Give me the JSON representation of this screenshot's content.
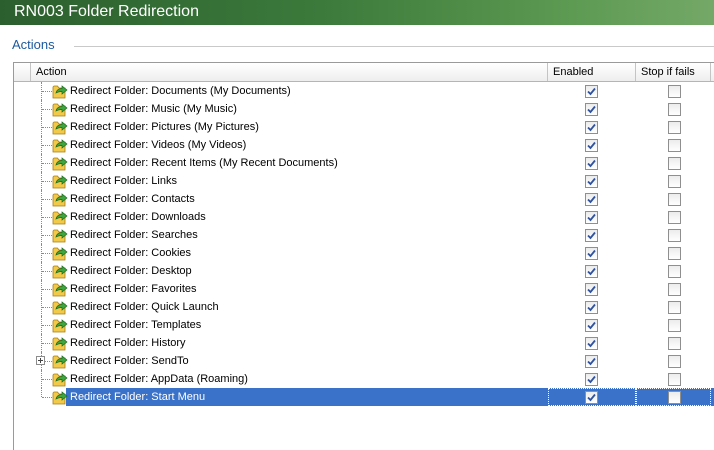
{
  "window": {
    "title": "RN003 Folder Redirection"
  },
  "section": {
    "title": "Actions"
  },
  "table": {
    "columns": {
      "action": "Action",
      "enabled": "Enabled",
      "stop": "Stop if fails"
    },
    "rows": [
      {
        "label": "Redirect Folder: Documents (My Documents)",
        "enabled": true,
        "stop_if_fails": false
      },
      {
        "label": "Redirect Folder: Music (My Music)",
        "enabled": true,
        "stop_if_fails": false
      },
      {
        "label": "Redirect Folder: Pictures (My Pictures)",
        "enabled": true,
        "stop_if_fails": false
      },
      {
        "label": "Redirect Folder: Videos (My Videos)",
        "enabled": true,
        "stop_if_fails": false
      },
      {
        "label": "Redirect Folder: Recent Items (My Recent Documents)",
        "enabled": true,
        "stop_if_fails": false
      },
      {
        "label": "Redirect Folder: Links",
        "enabled": true,
        "stop_if_fails": false
      },
      {
        "label": "Redirect Folder: Contacts",
        "enabled": true,
        "stop_if_fails": false
      },
      {
        "label": "Redirect Folder: Downloads",
        "enabled": true,
        "stop_if_fails": false
      },
      {
        "label": "Redirect Folder: Searches",
        "enabled": true,
        "stop_if_fails": false
      },
      {
        "label": "Redirect Folder: Cookies",
        "enabled": true,
        "stop_if_fails": false
      },
      {
        "label": "Redirect Folder: Desktop",
        "enabled": true,
        "stop_if_fails": false
      },
      {
        "label": "Redirect Folder: Favorites",
        "enabled": true,
        "stop_if_fails": false
      },
      {
        "label": "Redirect Folder: Quick Launch",
        "enabled": true,
        "stop_if_fails": false
      },
      {
        "label": "Redirect Folder: Templates",
        "enabled": true,
        "stop_if_fails": false
      },
      {
        "label": "Redirect Folder: History",
        "enabled": true,
        "stop_if_fails": false
      },
      {
        "label": "Redirect Folder: SendTo",
        "enabled": true,
        "stop_if_fails": false,
        "expandable": true
      },
      {
        "label": "Redirect Folder: AppData (Roaming)",
        "enabled": true,
        "stop_if_fails": false
      },
      {
        "label": "Redirect Folder: Start Menu",
        "enabled": true,
        "stop_if_fails": false,
        "selected": true
      }
    ]
  },
  "colors": {
    "title_bar": "#3b7a3b",
    "section_title": "#1c5a9e",
    "selection": "#3a72c9",
    "check": "#2f52a0"
  },
  "icons": {
    "row_icon": "folder-redirect-icon",
    "expander": "expand-plus-icon"
  }
}
